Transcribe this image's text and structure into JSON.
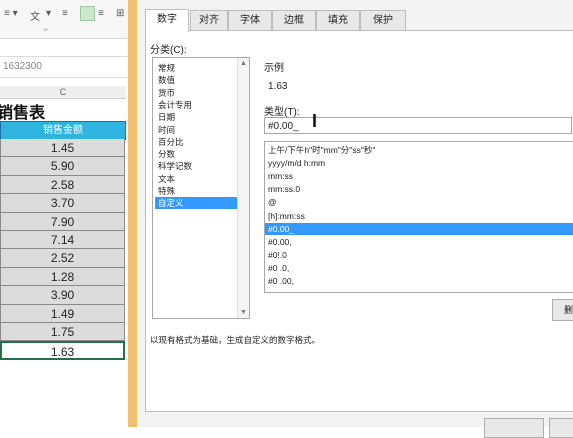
{
  "excel": {
    "ribbon_glyph": "文",
    "formula_value": "1632300",
    "col_letter": "C",
    "title": "销售表",
    "header": "销售金额",
    "values": [
      "1.45",
      "5.90",
      "2.58",
      "3.70",
      "7.90",
      "7.14",
      "2.52",
      "1.28",
      "3.90",
      "1.49",
      "1.75",
      "1.63"
    ]
  },
  "dialog": {
    "tabs": [
      "数字",
      "对齐",
      "字体",
      "边框",
      "填充",
      "保护"
    ],
    "category_label": "分类(C):",
    "categories": [
      "常规",
      "数值",
      "货币",
      "会计专用",
      "日期",
      "时间",
      "百分比",
      "分数",
      "科学记数",
      "文本",
      "特殊",
      "自定义"
    ],
    "selected_category": "自定义",
    "sample_label": "示例",
    "sample_value": "1.63",
    "type_label": "类型(T):",
    "type_value": "#0.00_",
    "formats": [
      "上午/下午h\"时\"mm\"分\"ss\"秒\"",
      "yyyy/m/d h:mm",
      "mm:ss",
      "mm:ss.0",
      "@",
      "[h]:mm:ss",
      "#0.00_",
      "#0.00,",
      "#0!.0",
      "#0 .0,",
      "#0 .00,"
    ],
    "selected_format": "#0.00_",
    "delete_label": "删除",
    "description": "以现有格式为基础，生成自定义的数字格式。"
  }
}
